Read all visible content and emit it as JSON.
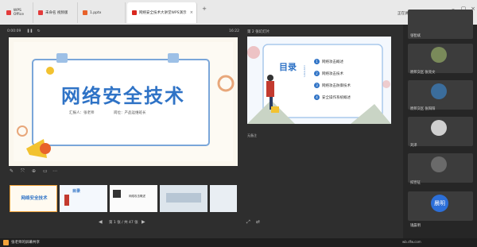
{
  "browser": {
    "tabs": [
      {
        "label": "WPS Office",
        "color": "#e33b3b",
        "active": false
      },
      {
        "label": "未命名 视频版",
        "color": "#e33b3b",
        "active": false
      },
      {
        "label": "1.pptx",
        "color": "#e8622b",
        "active": false
      },
      {
        "label": "网络安全技术大讲堂WPS演示",
        "color": "#d9281f",
        "active": true
      }
    ],
    "right_status": "正在讲课: 张老师"
  },
  "presenter": {
    "timer_left": "0:00:09",
    "timer_right": "16:22",
    "next_label": "第 2 张幻灯片",
    "notes_label": "无备注",
    "page_indicator": "第 1 张 / 共 47 张"
  },
  "slide_main": {
    "title": "网络安全技术",
    "reporter": "汇报人：张老师",
    "department": "岗位：产品运维班长"
  },
  "slide_next": {
    "heading": "目录",
    "subheading": "CONTENTS",
    "items": [
      {
        "num": "1",
        "text": "网络攻击概述"
      },
      {
        "num": "2",
        "text": "网络攻击技术"
      },
      {
        "num": "3",
        "text": "网络攻击防御技术"
      },
      {
        "num": "4",
        "text": "安全操作系统概述"
      }
    ]
  },
  "thumbnails": [
    {
      "caption": "网络安全技术"
    },
    {
      "caption": "目录"
    },
    {
      "caption": "网络攻击概述"
    },
    {
      "caption": ""
    },
    {
      "caption": ""
    }
  ],
  "participants": [
    {
      "name": "张智斌",
      "kind": "photo",
      "color": "#5a7a4a"
    },
    {
      "name": "原邦交区 张亮文",
      "kind": "photo",
      "color": "#7a8a5a"
    },
    {
      "name": "原邦交区 张阳阳",
      "kind": "photo",
      "color": "#3b6d9c"
    },
    {
      "name": "刘泽",
      "kind": "photo",
      "color": "#d0d0d0"
    },
    {
      "name": "扣宣征",
      "kind": "photo",
      "color": "#6a6a6a"
    },
    {
      "name": "镜晨明",
      "kind": "text",
      "initials": "晨明",
      "color": "#2c6fd8"
    }
  ],
  "bottom": {
    "share_label": "张老师的屏幕共享",
    "right_text": "wb.dfw.com"
  }
}
